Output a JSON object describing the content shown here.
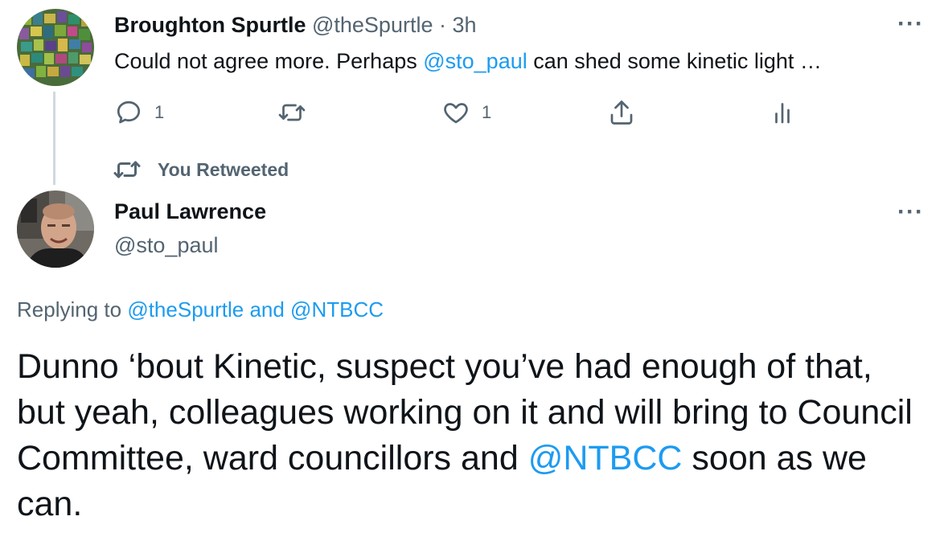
{
  "tweet1": {
    "author_name": "Broughton Spurtle",
    "author_handle": "@theSpurtle",
    "separator": "·",
    "time": "3h",
    "text_before": "Could not agree more. Perhaps ",
    "mention": "@sto_paul",
    "text_after": " can shed some kinetic light …",
    "reply_count": "1",
    "like_count": "1",
    "more_label": "···"
  },
  "retweet_label": "You Retweeted",
  "tweet2": {
    "author_name": "Paul Lawrence",
    "author_handle": "@sto_paul",
    "more_label": "···",
    "replying_prefix": "Replying to ",
    "replying_mentions": "@theSpurtle and @NTBCC",
    "text_before": "Dunno ‘bout Kinetic, suspect you’ve had enough of that, but yeah, colleagues working on it and will bring to Council Committee, ward councillors and ",
    "mention": "@NTBCC",
    "text_after": " soon as we can."
  },
  "icons": [
    "reply-icon",
    "retweet-icon",
    "like-icon",
    "share-icon",
    "analytics-icon",
    "retweet-small-icon"
  ],
  "colors": {
    "link": "#1d9bf0",
    "muted": "#536471",
    "text": "#0f1419",
    "thread": "#cfd9de"
  }
}
